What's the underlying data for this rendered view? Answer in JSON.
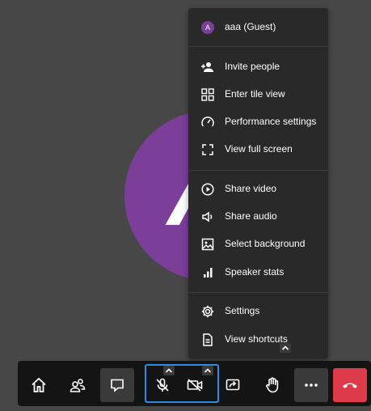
{
  "participant": {
    "initial": "A"
  },
  "menu": {
    "guest": {
      "initial": "A",
      "name": "aaa (Guest)"
    },
    "items": [
      {
        "icon": "add-person-icon",
        "label": "Invite people"
      },
      {
        "icon": "tile-view-icon",
        "label": "Enter tile view"
      },
      {
        "icon": "gauge-icon",
        "label": "Performance settings"
      },
      {
        "icon": "fullscreen-icon",
        "label": "View full screen"
      },
      {
        "icon": "play-circle-icon",
        "label": "Share video"
      },
      {
        "icon": "speaker-icon",
        "label": "Share audio"
      },
      {
        "icon": "image-icon",
        "label": "Select background"
      },
      {
        "icon": "bar-chart-icon",
        "label": "Speaker stats"
      },
      {
        "icon": "gear-icon",
        "label": "Settings"
      },
      {
        "icon": "document-icon",
        "label": "View shortcuts"
      }
    ]
  },
  "toolbar": {
    "buttons": [
      {
        "icon": "home-icon"
      },
      {
        "icon": "participants-icon"
      },
      {
        "icon": "chat-icon"
      },
      {
        "icon": "mic-muted-icon"
      },
      {
        "icon": "camera-off-icon"
      },
      {
        "icon": "share-screen-icon"
      },
      {
        "icon": "raise-hand-icon"
      },
      {
        "icon": "more-icon"
      },
      {
        "icon": "hangup-icon"
      }
    ],
    "colors": {
      "hangup": "#dd3a4a",
      "focus": "#2f8ae6",
      "avatar": "#7b3f9a"
    }
  }
}
